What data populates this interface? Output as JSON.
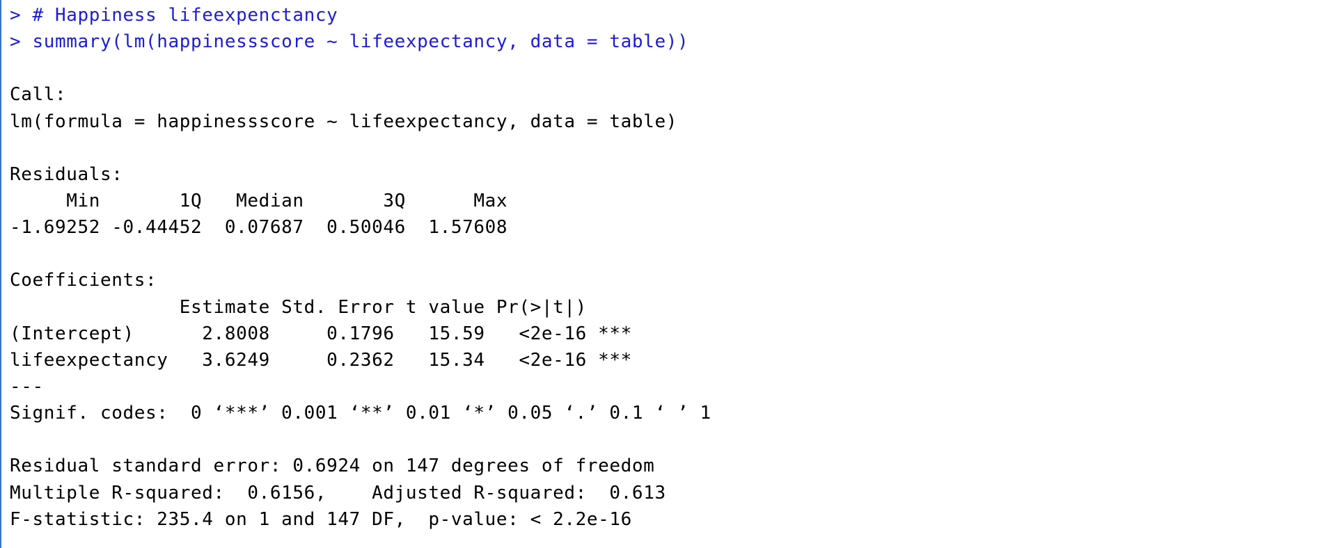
{
  "console": {
    "input_lines": [
      "> # Happiness lifeexpenctancy",
      "> summary(lm(happinessscore ~ lifeexpectancy, data = table))"
    ],
    "call_header": "Call:",
    "call_text": "lm(formula = happinessscore ~ lifeexpectancy, data = table)",
    "residuals_header": "Residuals:",
    "residuals_columns": "     Min       1Q   Median       3Q      Max ",
    "residuals_values": "-1.69252 -0.44452  0.07687  0.50046  1.57608 ",
    "coefficients_header": "Coefficients:",
    "coefficients_columns": "               Estimate Std. Error t value Pr(>|t|)    ",
    "coefficients_rows": [
      "(Intercept)      2.8008     0.1796   15.59   <2e-16 ***",
      "lifeexpectancy   3.6249     0.2362   15.34   <2e-16 ***"
    ],
    "separator": "---",
    "signif_codes": "Signif. codes:  0 ‘***’ 0.001 ‘**’ 0.01 ‘*’ 0.05 ‘.’ 0.1 ‘ ’ 1",
    "summary_lines": [
      "Residual standard error: 0.6924 on 147 degrees of freedom",
      "Multiple R-squared:  0.6156,\tAdjusted R-squared:  0.613 ",
      "F-statistic: 235.4 on 1 and 147 DF,  p-value: < 2.2e-16"
    ]
  },
  "colors": {
    "input_text": "#1c1cd6",
    "output_text": "#000000",
    "background": "#ffffff",
    "gutter_line": "#3a72c9"
  }
}
